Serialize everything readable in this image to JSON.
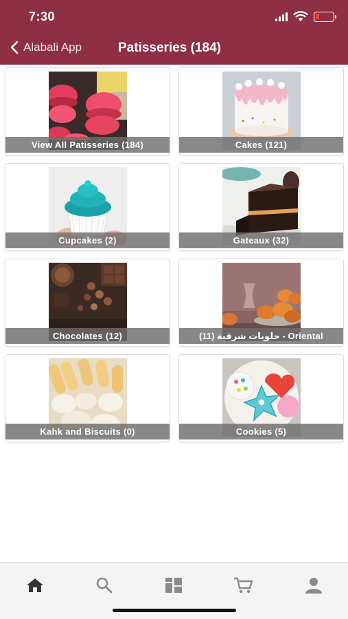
{
  "status_bar": {
    "time": "7:30"
  },
  "nav": {
    "back_label": "Alabali App",
    "title": "Patisseries (184)"
  },
  "categories": [
    {
      "label": "View All Patisseries (184)",
      "image": "macarons"
    },
    {
      "label": "Cakes (121)",
      "image": "drip-cake"
    },
    {
      "label": "Cupcakes (2)",
      "image": "cupcake"
    },
    {
      "label": "Gateaux (32)",
      "image": "chocolate-cake-slice"
    },
    {
      "label": "Chocolates (12)",
      "image": "chocolates"
    },
    {
      "label": "حلويات شرقية (11) - Oriental",
      "image": "oriental-sweets"
    },
    {
      "label": "Kahk and Biscuits (0)",
      "image": "biscuits"
    },
    {
      "label": "Cookies (5)",
      "image": "decorated-cookies"
    }
  ],
  "tabbar": {
    "items": [
      "home-icon",
      "search-icon",
      "categories-icon",
      "cart-icon",
      "profile-icon"
    ],
    "active": "home-icon"
  },
  "colors": {
    "brand": "#8e2f46",
    "caption_bg": "#6e6e6e",
    "tab_active": "#333333",
    "tab_inactive": "#8a8a8a"
  }
}
